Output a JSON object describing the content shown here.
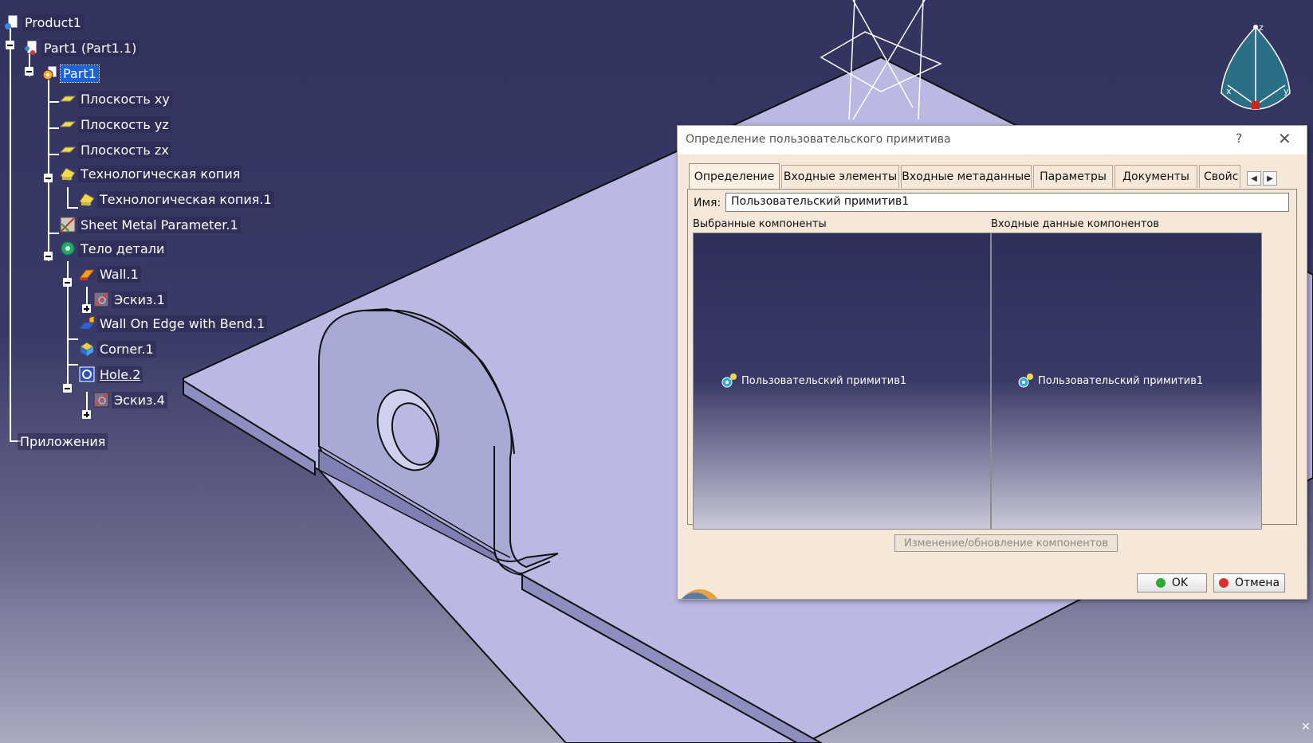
{
  "tree": {
    "items": [
      {
        "label": "Product1",
        "icon": "product-icon"
      },
      {
        "label": "Part1 (Part1.1)",
        "icon": "part-instance-icon"
      },
      {
        "label": "Part1",
        "icon": "part-gear-icon",
        "selected": true
      },
      {
        "label": "Плоскость xy",
        "icon": "plane-icon"
      },
      {
        "label": "Плоскость yz",
        "icon": "plane-icon"
      },
      {
        "label": "Плоскость zx",
        "icon": "plane-icon"
      },
      {
        "label": "Технологическая копия",
        "icon": "tech-copy-icon"
      },
      {
        "label": "Технологическая копия.1",
        "icon": "tech-copy-icon"
      },
      {
        "label": "Sheet Metal Parameter.1",
        "icon": "sheet-metal-parameter-icon"
      },
      {
        "label": "Тело детали",
        "icon": "part-body-icon"
      },
      {
        "label": "Wall.1",
        "icon": "wall-icon"
      },
      {
        "label": "Эскиз.1",
        "icon": "sketch-icon"
      },
      {
        "label": "Wall On Edge with Bend.1",
        "icon": "wall-on-edge-icon"
      },
      {
        "label": "Corner.1",
        "icon": "corner-icon"
      },
      {
        "label": "Hole.2",
        "icon": "hole-icon",
        "underlined": true
      },
      {
        "label": "Эскиз.4",
        "icon": "sketch-icon"
      },
      {
        "label": "Приложения",
        "icon": ""
      }
    ]
  },
  "compass": {
    "x_label": "x",
    "y_label": "y",
    "z_label": "z"
  },
  "dialog": {
    "title": "Определение пользовательского примитива",
    "help_glyph": "?",
    "close_glyph": "✕",
    "tabs": [
      "Определение",
      "Входные элементы",
      "Входные метаданные",
      "Параметры",
      "Документы",
      "Свойс"
    ],
    "active_tab": "Определение",
    "tab_prev_glyph": "◀",
    "tab_next_glyph": "▶",
    "name_label": "Имя:",
    "name_value": "Пользовательский примитив1",
    "selected_components_header": "Выбранные компоненты",
    "input_data_header": "Входные данные компонентов",
    "selected_component_item": "Пользовательский примитив1",
    "input_component_item": "Пользовательский примитив1",
    "update_button": "Изменение/обновление компонентов",
    "ok_button": "OK",
    "cancel_button": "Отмена",
    "colors": {
      "ok_dot": "#2fa83a",
      "cancel_dot": "#d9322c",
      "selection": "#1a64d8"
    }
  },
  "corner_glyph": "✕"
}
